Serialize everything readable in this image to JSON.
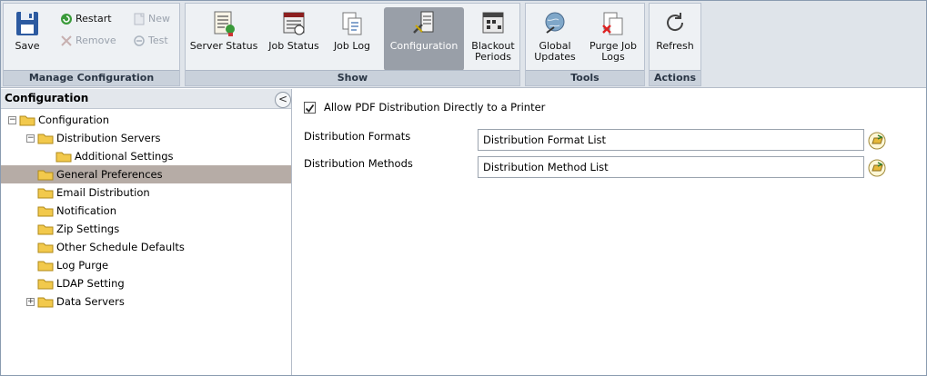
{
  "ribbon": {
    "manage": {
      "label": "Manage Configuration",
      "save": "Save",
      "restart": "Restart",
      "remove": "Remove",
      "new": "New",
      "test": "Test"
    },
    "show": {
      "label": "Show",
      "server_status": "Server Status",
      "job_status": "Job Status",
      "job_log": "Job Log",
      "configuration": "Configuration",
      "blackout_1": "Blackout",
      "blackout_2": "Periods"
    },
    "tools": {
      "label": "Tools",
      "global_1": "Global",
      "global_2": "Updates",
      "purge_1": "Purge Job",
      "purge_2": "Logs"
    },
    "actions": {
      "label": "Actions",
      "refresh": "Refresh"
    }
  },
  "left_panel": {
    "title": "Configuration",
    "collapse_glyph": "<",
    "tree": [
      {
        "label": "Configuration",
        "expander": "⊟"
      },
      {
        "label": "Distribution Servers",
        "expander": "⊟"
      },
      {
        "label": "Additional Settings"
      },
      {
        "label": "General Preferences",
        "selected": true
      },
      {
        "label": "Email Distribution"
      },
      {
        "label": "Notification"
      },
      {
        "label": "Zip Settings"
      },
      {
        "label": "Other Schedule Defaults"
      },
      {
        "label": "Log Purge"
      },
      {
        "label": "LDAP Setting"
      },
      {
        "label": "Data Servers",
        "expander": "⊞"
      }
    ]
  },
  "right_panel": {
    "allow_pdf": {
      "label": "Allow PDF Distribution Directly to a Printer",
      "checked": true,
      "check_glyph": "✓"
    },
    "distribution_formats": {
      "label": "Distribution Formats",
      "value": "Distribution Format List"
    },
    "distribution_methods": {
      "label": "Distribution Methods",
      "value": "Distribution Method List"
    }
  },
  "colors": {
    "ribbon_bg": "#dfe4ea",
    "group_label_bg": "#c9d1db",
    "active_button": "#999fa8",
    "selected_row": "#b6aca6",
    "folder": "#f2c94c"
  }
}
